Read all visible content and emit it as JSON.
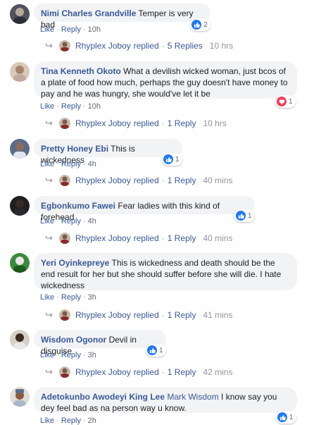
{
  "action_labels": {
    "like": "Like",
    "reply": "Reply",
    "dot": "·"
  },
  "comments": [
    {
      "author": "Nimi Charles Grandville",
      "text": "Temper is very bad",
      "time": "10h",
      "reaction_type": "like",
      "reaction_count": "2",
      "reply": {
        "name": "Rhyplex Joboy",
        "replied": "replied",
        "count": "5 Replies",
        "time": "10 hrs"
      }
    },
    {
      "author": "Tina Kenneth Okoto",
      "text": "What a devilish wicked woman, just bcos of a plate of food how much, perhaps the guy doesn't have money to pay and he was hungry, she would've let it be",
      "time": "10h",
      "reaction_type": "love",
      "reaction_count": "1",
      "reply": {
        "name": "Rhyplex Joboy",
        "replied": "replied",
        "count": "1 Reply",
        "time": "10 hrs"
      }
    },
    {
      "author": "Pretty Honey Ebi",
      "text": "This is wickedness",
      "time": "4h",
      "reaction_type": "like",
      "reaction_count": "1",
      "reply": {
        "name": "Rhyplex Joboy",
        "replied": "replied",
        "count": "1 Reply",
        "time": "40 mins"
      }
    },
    {
      "author": "Egbonkumo Fawei",
      "text": "Fear ladies with this kind of forehead",
      "time": "4h",
      "reaction_type": "like",
      "reaction_count": "1",
      "reply": {
        "name": "Rhyplex Joboy",
        "replied": "replied",
        "count": "1 Reply",
        "time": "40 mins"
      }
    },
    {
      "author": "Yeri Oyinkepreye",
      "text": "This is wickedness and death should be the end result for her but she should suffer before she will die. I hate wickedness",
      "time": "3h",
      "reaction_type": "",
      "reaction_count": "",
      "reply": {
        "name": "Rhyplex Joboy",
        "replied": "replied",
        "count": "1 Reply",
        "time": "41 mins"
      }
    },
    {
      "author": "Wisdom Ogonor",
      "text": "Devil in disguise",
      "time": "3h",
      "reaction_type": "like",
      "reaction_count": "1",
      "reply": {
        "name": "Rhyplex Joboy",
        "replied": "replied",
        "count": "1 Reply",
        "time": "42 mins"
      }
    },
    {
      "author": "Adetokunbo Awodeyi King Lee",
      "mention": "Mark Wisdom",
      "text": "I know say you dey feel bad as na person way u know.",
      "time": "2h",
      "reaction_type": "like",
      "reaction_count": "1"
    }
  ],
  "colors": {
    "link": "#385898",
    "bubble": "#f2f3f5",
    "like": "#2078f4",
    "love": "#f33e58"
  }
}
